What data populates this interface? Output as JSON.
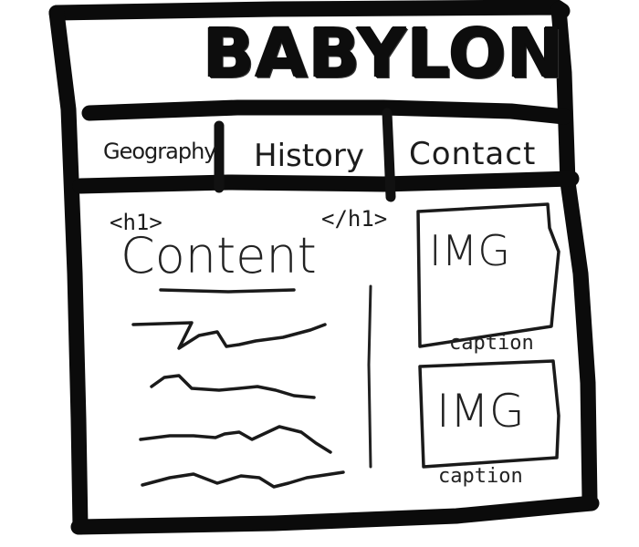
{
  "header": {
    "title": "BABYLON"
  },
  "nav": {
    "items": [
      {
        "label": "Geography"
      },
      {
        "label": "History"
      },
      {
        "label": "Contact"
      }
    ]
  },
  "content": {
    "open_tag": "<h1>",
    "close_tag": "</h1>",
    "heading": "Content"
  },
  "sidebar": {
    "images": [
      {
        "label": "IMG",
        "caption": "caption"
      },
      {
        "label": "IMG",
        "caption": "caption"
      }
    ]
  }
}
